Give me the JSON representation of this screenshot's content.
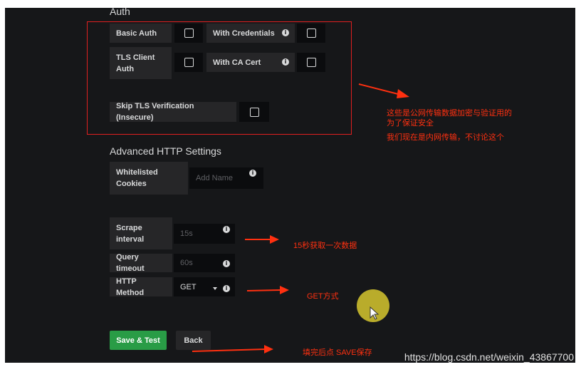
{
  "auth": {
    "title": "Auth",
    "basic_auth_label": "Basic Auth",
    "with_credentials_label": "With Credentials",
    "tls_client_auth_label": "TLS Client Auth",
    "with_ca_cert_label": "With CA Cert",
    "skip_tls_label": "Skip TLS Verification (Insecure)"
  },
  "advanced": {
    "title": "Advanced HTTP Settings",
    "whitelisted_cookies_label": "Whitelisted Cookies",
    "cookies_placeholder": "Add Name"
  },
  "prometheus": {
    "scrape_interval_label": "Scrape interval",
    "scrape_interval_placeholder": "15s",
    "query_timeout_label": "Query timeout",
    "query_timeout_placeholder": "60s",
    "http_method_label": "HTTP Method",
    "http_method_value": "GET"
  },
  "buttons": {
    "save_test": "Save & Test",
    "back": "Back"
  },
  "annotations": {
    "tls_note_line1": "这些是公网传输数据加密与验证用的",
    "tls_note_line2": "为了保证安全",
    "tls_note_line3": "我们现在是内网传输，不讨论这个",
    "scrape_note": "15秒获取一次数据",
    "method_note": "GET方式",
    "save_note": "填完后点 SAVE保存"
  },
  "watermark": "https://blog.csdn.net/weixin_43867700",
  "colors": {
    "panel_bg": "#161719",
    "label_bg": "#262628",
    "input_bg": "#0b0c0e",
    "primary_button": "#299c46",
    "annotation_red": "#ff3010"
  }
}
